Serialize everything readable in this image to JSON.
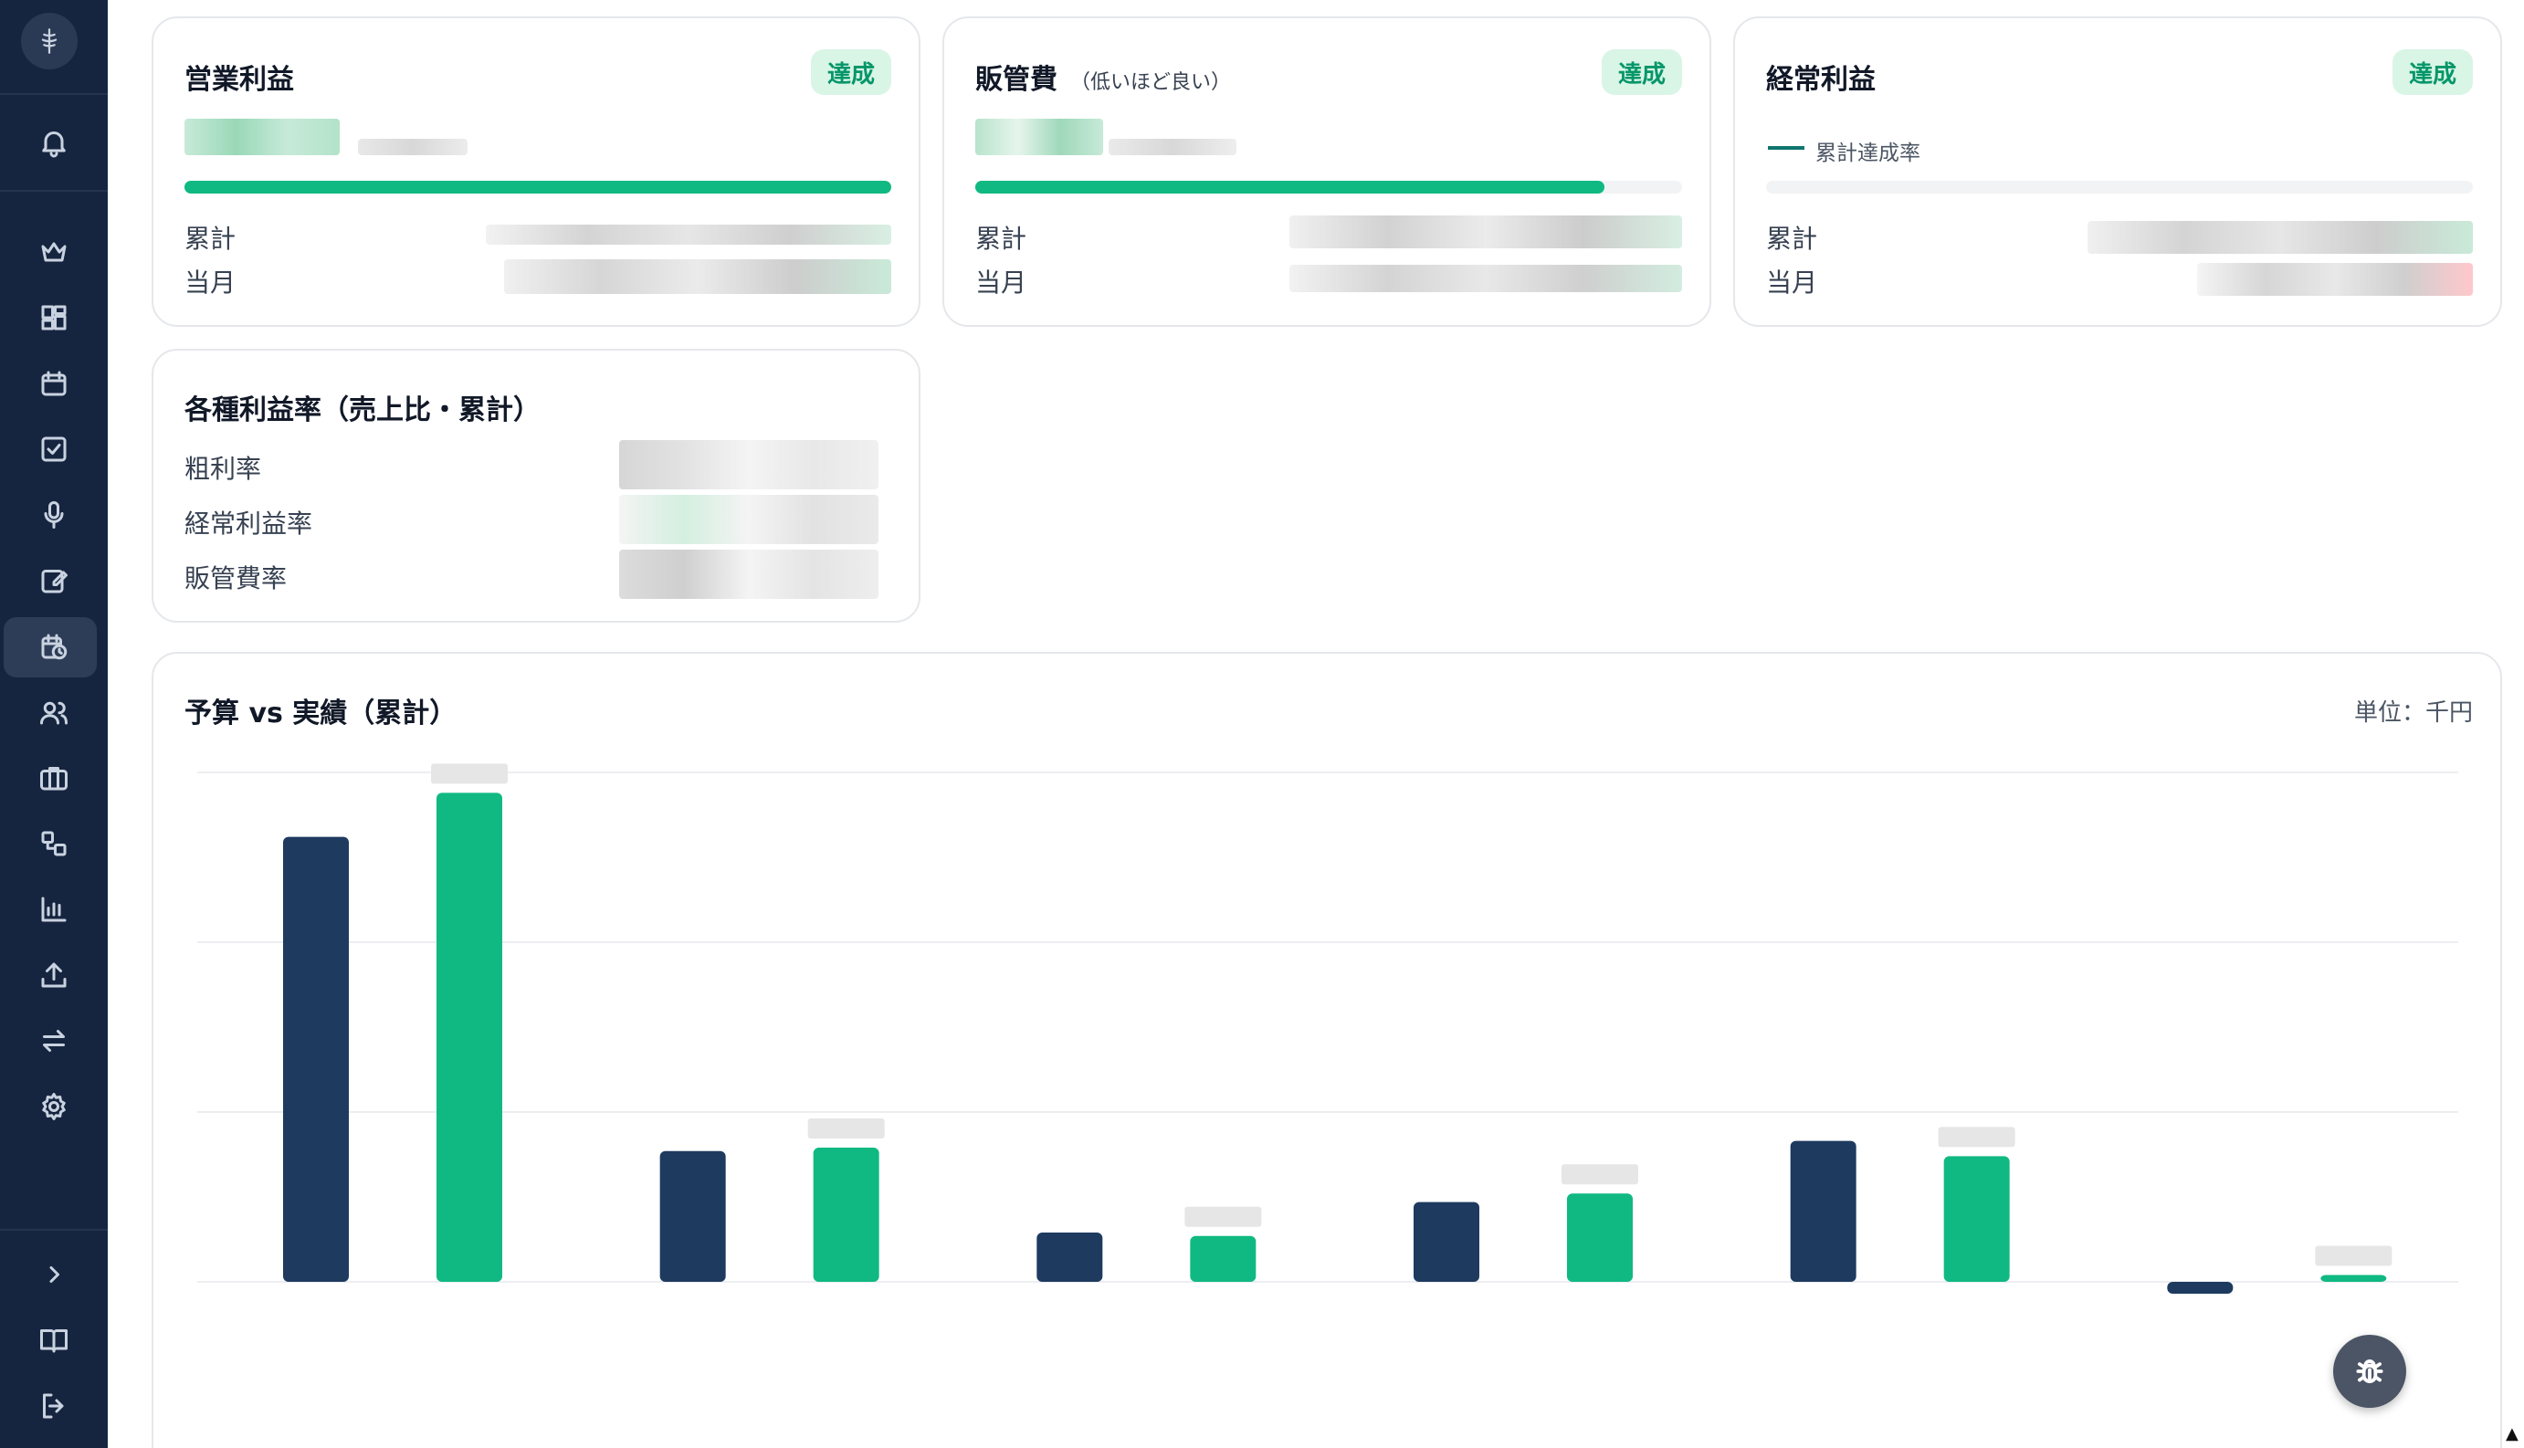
{
  "sidebar": {
    "icons": [
      "logo-icon",
      "bell-icon",
      "crown-icon",
      "dashboard-grid-icon",
      "calendar-icon",
      "checkbox-icon",
      "microphone-icon",
      "edit-note-icon",
      "calendar-clock-icon",
      "users-icon",
      "briefcase-icon",
      "workflow-icon",
      "bar-chart-icon",
      "upload-icon",
      "transfer-icon",
      "gear-icon",
      "chevron-right-icon",
      "book-icon",
      "logout-icon"
    ],
    "active": "calendar-clock-icon"
  },
  "cards": {
    "operating_profit": {
      "title": "営業利益",
      "badge": "達成",
      "row1": "累計",
      "row2": "当月",
      "progress": 1.0
    },
    "sga": {
      "title": "販管費",
      "subtitle": "（低いほど良い）",
      "badge": "達成",
      "row1": "累計",
      "row2": "当月",
      "progress": 0.89
    },
    "ordinary_profit": {
      "title": "経常利益",
      "badge": "達成",
      "legend": "累計達成率",
      "row1": "累計",
      "row2": "当月"
    },
    "ratios": {
      "title": "各種利益率（売上比・累計）",
      "rows": [
        "粗利率",
        "経常利益率",
        "販管費率"
      ]
    }
  },
  "chart": {
    "title": "予算 vs 実績（累計）",
    "unit": "単位：千円"
  },
  "chart_data": {
    "type": "bar",
    "categories": [
      "",
      "",
      "",
      "",
      "",
      ""
    ],
    "series": [
      {
        "values": [
          262,
          77,
          29,
          47,
          83,
          -7
        ]
      },
      {
        "values": [
          288,
          79,
          27,
          52,
          74,
          4
        ]
      }
    ],
    "colors": [
      "#1e3a5f",
      "#10b981"
    ],
    "ylim": [
      0,
      300
    ],
    "grid": true
  },
  "fab": {
    "icon": "bug-icon"
  }
}
